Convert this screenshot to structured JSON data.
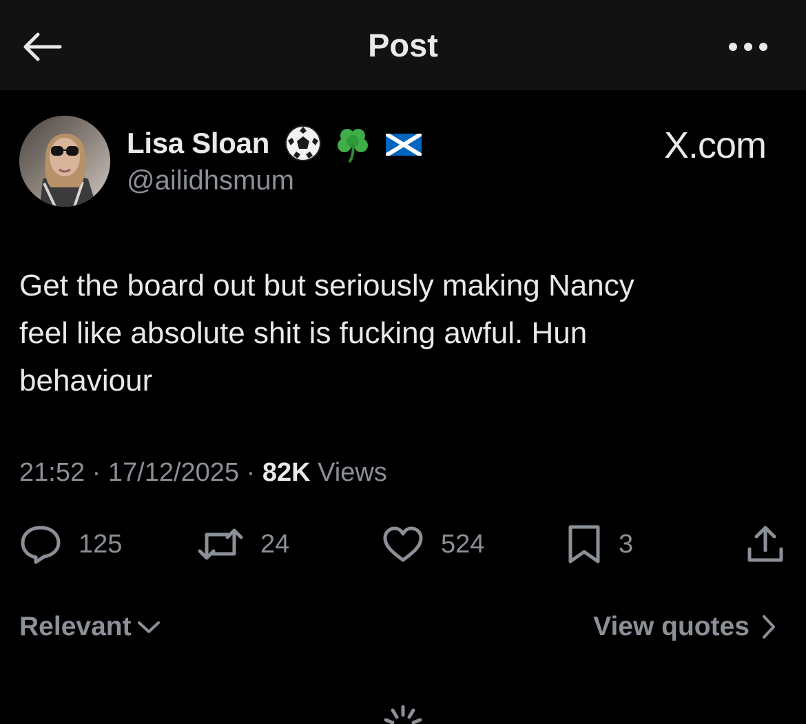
{
  "header": {
    "title": "Post",
    "back_icon": "arrow-left-icon",
    "more_icon": "more-horizontal-icon"
  },
  "author": {
    "display_name": "Lisa Sloan",
    "name_emojis": [
      "soccer-ball-emoji",
      "shamrock-emoji",
      "scotland-flag-emoji"
    ],
    "handle": "@ailidhsmum"
  },
  "watermark": "X.com",
  "post": {
    "text": "Get the board out but seriously making Nancy\nfeel like absolute shit is fucking awful. Hun\nbehaviour"
  },
  "meta": {
    "time": "21:52",
    "separator": " · ",
    "date": "17/12/2025",
    "views_count": "82K",
    "views_label": "Views"
  },
  "actions": {
    "replies": "125",
    "reposts": "24",
    "likes": "524",
    "bookmarks": "3"
  },
  "footer": {
    "sort_label": "Relevant",
    "quotes_label": "View quotes"
  },
  "colors": {
    "background": "#000000",
    "header_bg": "#121212",
    "text_primary": "#e7e9ea",
    "text_secondary": "#8b9097"
  }
}
